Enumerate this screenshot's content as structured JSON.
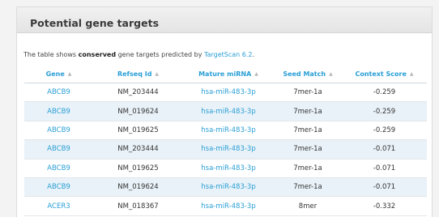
{
  "panel": {
    "title": "Potential gene targets"
  },
  "intro": {
    "prefix": "The table shows ",
    "bold": "conserved",
    "middle": " gene targets predicted by ",
    "link": "TargetScan 6.2",
    "suffix": "."
  },
  "table": {
    "headers": [
      "Gene",
      "Refseq Id",
      "Mature miRNA",
      "Seed Match",
      "Context Score"
    ],
    "sort_icon": "sort-arrow-icon",
    "rows": [
      [
        "ABCB9",
        "NM_203444",
        "hsa-miR-483-3p",
        "7mer-1a",
        "-0.259"
      ],
      [
        "ABCB9",
        "NM_019624",
        "hsa-miR-483-3p",
        "7mer-1a",
        "-0.259"
      ],
      [
        "ABCB9",
        "NM_019625",
        "hsa-miR-483-3p",
        "7mer-1a",
        "-0.259"
      ],
      [
        "ABCB9",
        "NM_203444",
        "hsa-miR-483-3p",
        "7mer-1a",
        "-0.071"
      ],
      [
        "ABCB9",
        "NM_019625",
        "hsa-miR-483-3p",
        "7mer-1a",
        "-0.071"
      ],
      [
        "ABCB9",
        "NM_019624",
        "hsa-miR-483-3p",
        "7mer-1a",
        "-0.071"
      ],
      [
        "ACER3",
        "NM_018367",
        "hsa-miR-483-3p",
        "8mer",
        "-0.332"
      ]
    ]
  },
  "colors": {
    "link": "#2a9fd6",
    "row_alt": "#e9f2f8",
    "header_bg": "#e4e4e4"
  }
}
